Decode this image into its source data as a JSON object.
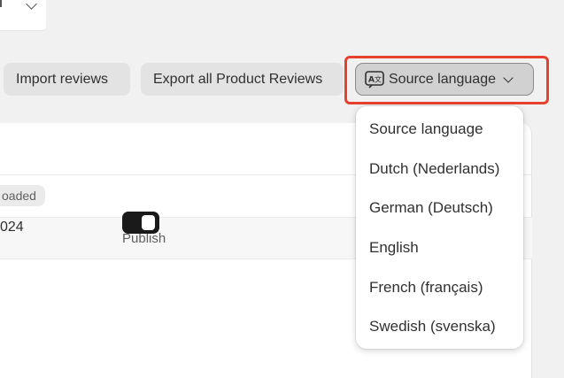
{
  "toolbar": {
    "import_label": "Import reviews",
    "export_label": "Export all Product Reviews",
    "language_button_label": "Source language"
  },
  "language_menu": {
    "options": [
      "Source language",
      "Dutch (Nederlands)",
      "German (Deutsch)",
      "English",
      "French (français)",
      "Swedish (svenska)"
    ]
  },
  "table": {
    "publish_header": "Publish",
    "row": {
      "status_badge": "oaded",
      "date_fragment": "024",
      "published": true
    }
  },
  "colors": {
    "highlight": "#e6412e",
    "toggle_on": "#1a1a1a"
  },
  "icons": {
    "language": "translate-icon",
    "dropdown": "chevron-down-icon"
  }
}
